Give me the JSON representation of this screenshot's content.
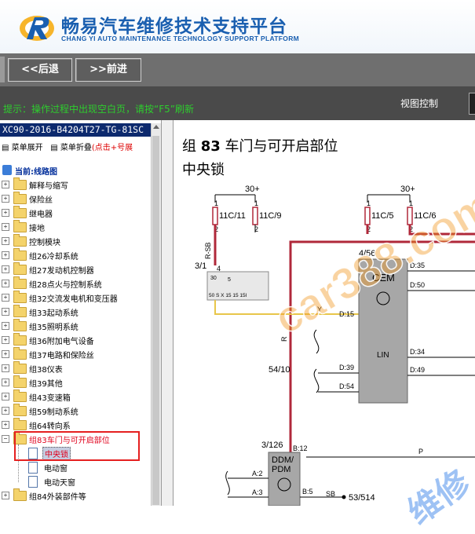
{
  "header": {
    "title_cn": "畅易汽车维修技术支持平台",
    "title_en": "CHANG YI AUTO MAINTENANCE TECHNOLOGY SUPPORT PLATFORM"
  },
  "toolbar": {
    "back_label": "<<后退",
    "forward_label": ">>前进"
  },
  "hintbar": {
    "hint": "提示：操作过程中出现空白页，请按“F5”刷新",
    "view_control": "视图控制"
  },
  "left": {
    "doc_title": "XC90-2016-B4204T27-TG-81SC",
    "expand_label": "菜单展开",
    "collapse_label": "菜单折叠",
    "collapse_hint": "(点击+号展",
    "root_label": "当前:线路图",
    "items": [
      "解释与缩写",
      "保险丝",
      "继电器",
      "接地",
      "控制模块",
      "组26冷却系统",
      "组27发动机控制器",
      "组28点火与控制系统",
      "组32交流发电机和变压器",
      "组33起动系统",
      "组35照明系统",
      "组36附加电气设备",
      "组37电路和保险丝",
      "组38仪表",
      "组39其他",
      "组43变速箱",
      "组59制动系统",
      "组64转向系"
    ],
    "selected_group": "组83车门与可开启部位",
    "sub_items": [
      "中央锁",
      "电动窗",
      "电动天窗"
    ],
    "last_item": "组84外装部件等"
  },
  "main": {
    "title_prefix": "组",
    "title_num": "83",
    "title_rest": "车门与可开启部位",
    "subtitle": "中央锁",
    "labels": {
      "p30a": "30+",
      "p30b": "30+",
      "f1": "11C/11",
      "f2": "11C/9",
      "f3": "11C/5",
      "f4": "11C/6",
      "n1a": "1",
      "n2a": "2",
      "n1b": "1",
      "n2b": "2",
      "n1c": "1",
      "n2c": "2",
      "n1d": "1",
      "n2d": "2",
      "rsb": "R-SB",
      "c31": "3/1",
      "c31pin": "4",
      "relay30": "30",
      "relay5": "5",
      "relay_pins": "50   S    X   15  15  15I",
      "c456": "4/56",
      "cem": "CEM",
      "lin": "LIN",
      "d35": "D:35",
      "d50": "D:50",
      "d15": "D:15",
      "d34": "D:34",
      "d49": "D:49",
      "d39": "D:39",
      "d54": "D:54",
      "y": "Y",
      "r": "R",
      "c5410": "54/10",
      "c3126": "3/126",
      "b12": "B:12",
      "ddm": "DDM/",
      "pdm": "PDM",
      "a2": "A:2",
      "a3": "A:3",
      "b5": "B:5",
      "sb": "SB",
      "c53514": "53/514",
      "p": "P"
    }
  },
  "watermark": {
    "text": "car388.com",
    "text2": "维修"
  },
  "colors": {
    "accent": "#1a5fb0",
    "hint": "#2ecc2e",
    "wire_red": "#b0283a",
    "wire_yellow": "#e8c64a",
    "highlight": "#e52020"
  }
}
